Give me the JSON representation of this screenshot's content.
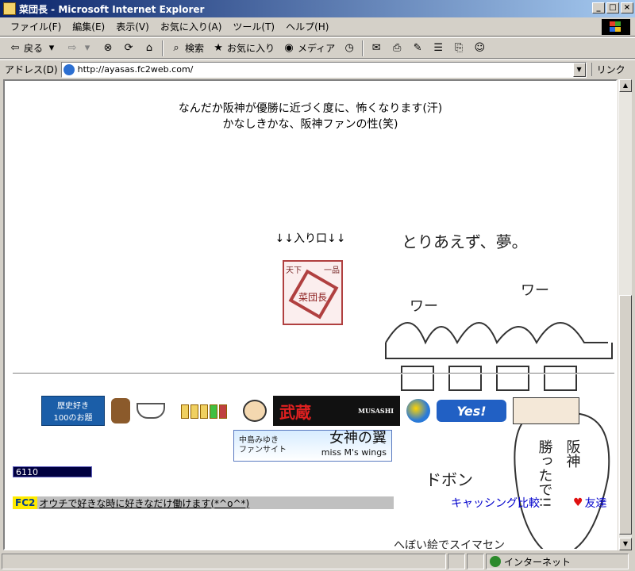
{
  "window": {
    "title": "菜団長 - Microsoft Internet Explorer",
    "buttons": {
      "minimize": "_",
      "maximize": "□",
      "close": "×"
    }
  },
  "menu": [
    "ファイル(F)",
    "編集(E)",
    "表示(V)",
    "お気に入り(A)",
    "ツール(T)",
    "ヘルプ(H)"
  ],
  "toolbar": {
    "back": "戻る",
    "search": "検索",
    "favorites": "お気に入り",
    "media": "メディア"
  },
  "address": {
    "label": "アドレス(D)",
    "url": "http://ayasas.fc2web.com/",
    "links": "リンク"
  },
  "page": {
    "line1": "なんだか阪神が優勝に近づく度に、怖くなります(汗)",
    "line2": "かなしきかな、阪神ファンの性(笑)",
    "entrance": "↓↓入り口↓↓",
    "stamp": {
      "top_left": "天下",
      "top_right": "一品",
      "center": "菜団長"
    },
    "banners": {
      "rekishi": "歴史好き",
      "rekishi_sub": "100のお題",
      "musashi": "武蔵",
      "musashi_sub": "MUSASHI",
      "yes_brand": "Yes!",
      "megami_left_1": "中島みゆき",
      "megami_left_2": "ファンサイト",
      "megami_title": "女神の翼",
      "megami_sub": "miss M's wings"
    },
    "counter": "6110",
    "fc2_logo": "FC2",
    "fc2_text": "オウチで好きな時に好きなだけ働けます(*^o^*)",
    "caching": "キャッシング比較",
    "friend": "友達",
    "doodle_texts": {
      "top": "とりあえず、夢。",
      "shout": "ワー",
      "don": "ドボン",
      "hanshin": "阪神",
      "win": "勝ったで!!",
      "bottom": "へぼい絵でスイマセン"
    }
  },
  "status": {
    "zone": "インターネット"
  }
}
